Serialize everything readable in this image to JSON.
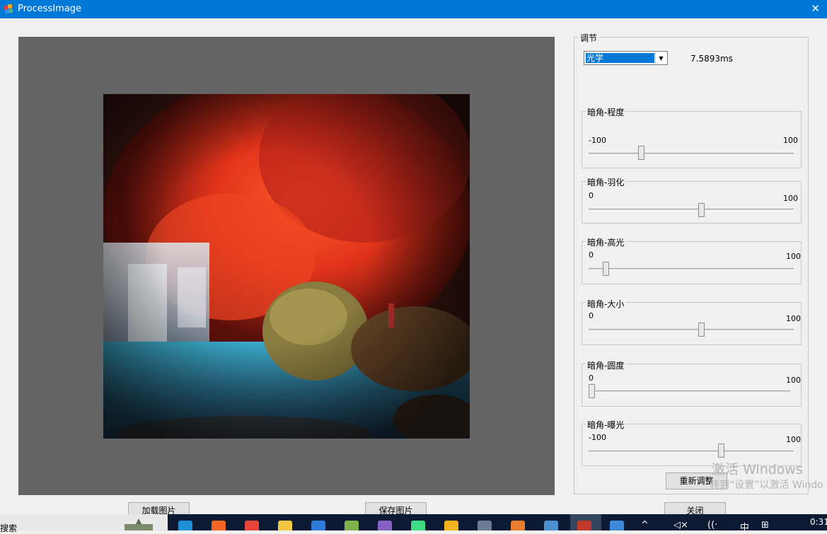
{
  "window": {
    "title": "ProcessImage"
  },
  "adjust": {
    "group_title": "调节",
    "mode_select": {
      "value": "光学"
    },
    "timing": "7.5893ms"
  },
  "sliders": [
    {
      "label": "暗角-程度",
      "min": "-100",
      "max": "100",
      "value": -50
    },
    {
      "label": "暗角-羽化",
      "min": "0",
      "max": "100",
      "value": 55
    },
    {
      "label": "暗角-高光",
      "min": "0",
      "max": "100",
      "value": 7
    },
    {
      "label": "暗角-大小",
      "min": "0",
      "max": "100",
      "value": 55
    },
    {
      "label": "暗角-圆度",
      "min": "0",
      "max": "100",
      "value": 0
    },
    {
      "label": "暗角-曝光",
      "min": "-100",
      "max": "100",
      "value": 30
    }
  ],
  "buttons": {
    "reset": "重新调整",
    "load": "加载图片",
    "save": "保存图片",
    "close": "关闭"
  },
  "watermark": {
    "line1": "激活 Windows",
    "line2": "转到“设置”以激活 Windo"
  },
  "taskbar": {
    "search_text": "搜索",
    "ime_label": "中",
    "clock": "0:31",
    "icons": [
      "edge-icon",
      "app-icon-orange",
      "chrome-icon",
      "folder-icon",
      "store-icon",
      "notepad-icon",
      "visual-studio-icon",
      "android-studio-icon",
      "app-icon-yellow",
      "calculator-icon",
      "paint-icon",
      "photo-viewer-icon",
      "process-image-icon",
      "image-icon"
    ]
  }
}
